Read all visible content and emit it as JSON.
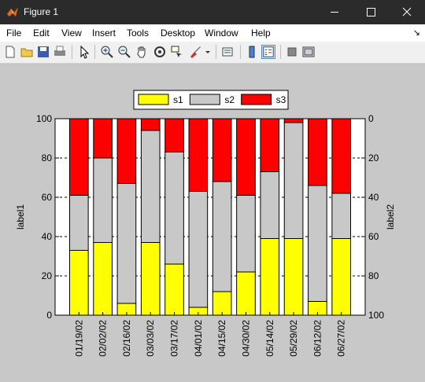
{
  "window": {
    "title": "Figure 1"
  },
  "menu": [
    "File",
    "Edit",
    "View",
    "Insert",
    "Tools",
    "Desktop",
    "Window",
    "Help"
  ],
  "toolbar": {
    "icons": [
      "new-figure-icon",
      "open-file-icon",
      "save-icon",
      "print-icon",
      "select-arrow-icon",
      "zoom-in-icon",
      "zoom-out-icon",
      "pan-hand-icon",
      "rotate-3d-icon",
      "data-cursor-icon",
      "brush-icon",
      "brush-dropdown-icon",
      "link-plot-icon",
      "colorbar-icon",
      "legend-icon",
      "hide-plot-tools-icon",
      "show-plot-tools-icon"
    ]
  },
  "chart_data": {
    "type": "bar",
    "stacked": true,
    "categories": [
      "01/19/02",
      "02/02/02",
      "02/16/02",
      "03/03/02",
      "03/17/02",
      "04/01/02",
      "04/15/02",
      "04/30/02",
      "05/14/02",
      "05/29/02",
      "06/12/02",
      "06/27/02"
    ],
    "series": [
      {
        "name": "s1",
        "color": "#ffff00",
        "values": [
          33,
          37,
          6,
          37,
          26,
          4,
          12,
          22,
          39,
          39,
          7,
          39
        ]
      },
      {
        "name": "s2",
        "color": "#c8c8c8",
        "values": [
          28,
          43,
          61,
          57,
          57,
          59,
          56,
          39,
          34,
          59,
          59,
          23
        ]
      },
      {
        "name": "s3",
        "color": "#ff0000",
        "values": [
          39,
          20,
          33,
          6,
          17,
          37,
          32,
          39,
          27,
          2,
          34,
          38
        ]
      }
    ],
    "ylabel": "label1",
    "ylim": [
      0,
      100
    ],
    "yticks": [
      "0",
      "20",
      "40",
      "60",
      "80",
      "100"
    ],
    "y2label": "label2",
    "y2lim": [
      100,
      0
    ],
    "y2ticks": [
      "0",
      "20",
      "40",
      "60",
      "80",
      "100"
    ],
    "legend": {
      "position": "top-center",
      "orientation": "horizontal",
      "entries": [
        "s1",
        "s2",
        "s3"
      ]
    },
    "grid": false,
    "right_axis_dashed_gridlines": true
  },
  "colors": {
    "figure_bg": "#c8c8c8",
    "axes_bg": "#ffffff",
    "titlebar": "#2b2b2b"
  }
}
